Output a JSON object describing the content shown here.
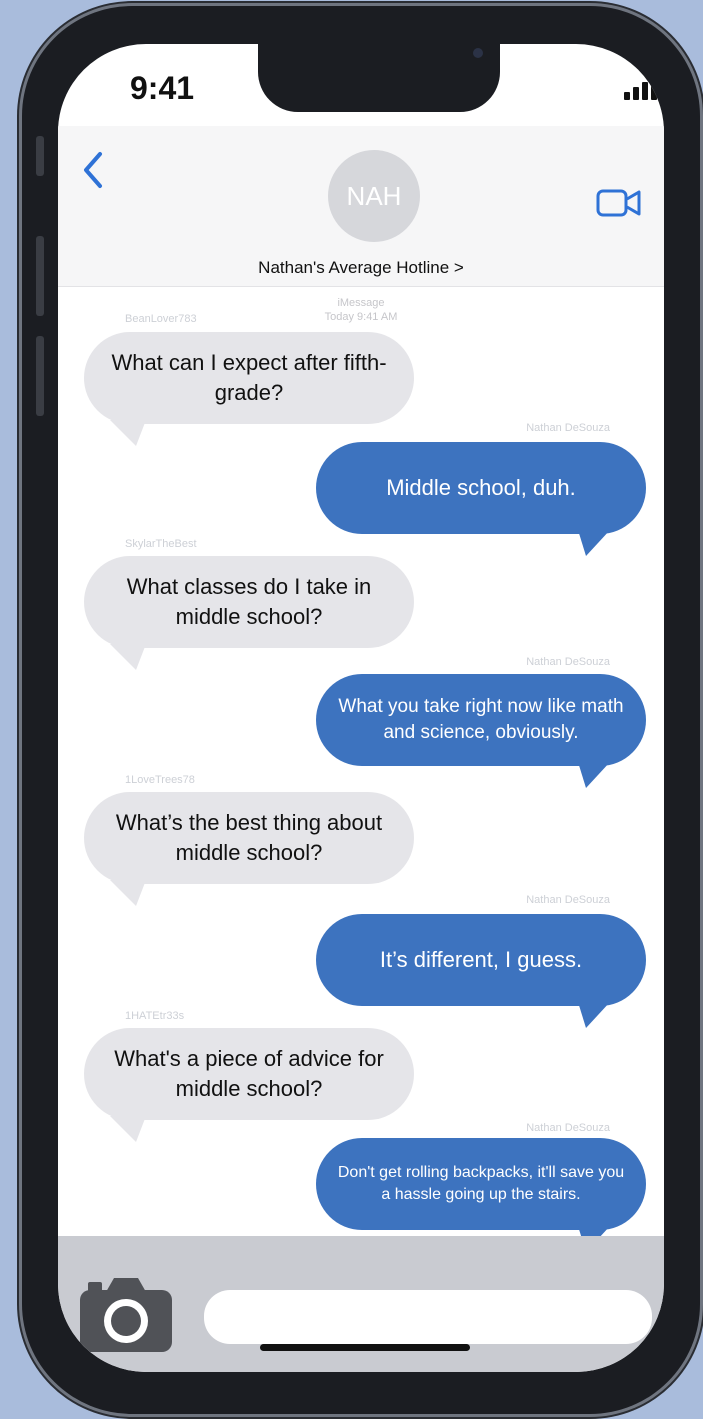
{
  "status_bar": {
    "time": "9:41"
  },
  "header": {
    "avatar_initials": "NAH",
    "contact_name": "Nathan's Average Hotline >",
    "service": "iMessage",
    "timestamp": "Today 9:41 AM"
  },
  "messages": [
    {
      "sender": "BeanLover783",
      "text": "What can I expect after fifth-grade?",
      "direction": "incoming"
    },
    {
      "sender": "Nathan DeSouza",
      "text": "Middle school, duh.",
      "direction": "outgoing"
    },
    {
      "sender": "SkylarTheBest",
      "text": "What classes do I take in middle school?",
      "direction": "incoming"
    },
    {
      "sender": "Nathan DeSouza",
      "text": "What you take right now like math and science, obviously.",
      "direction": "outgoing"
    },
    {
      "sender": "1LoveTrees78",
      "text": "What’s the best thing about middle school?",
      "direction": "incoming"
    },
    {
      "sender": "Nathan DeSouza",
      "text": "It’s different, I guess.",
      "direction": "outgoing"
    },
    {
      "sender": "1HATEtr33s",
      "text": "What's a piece of advice for middle school?",
      "direction": "incoming"
    },
    {
      "sender": "Nathan DeSouza",
      "text": "Don't get rolling backpacks, it'll save you a hassle going up the stairs.",
      "direction": "outgoing"
    }
  ],
  "compose": {
    "input_value": ""
  },
  "colors": {
    "outgoing_bubble": "#3d73bf",
    "incoming_bubble": "#e5e5e9",
    "accent": "#2f72d6",
    "background": "#a9bcdc"
  },
  "icons": {
    "back": "chevron-left-icon",
    "video": "video-camera-icon",
    "camera": "camera-icon"
  }
}
